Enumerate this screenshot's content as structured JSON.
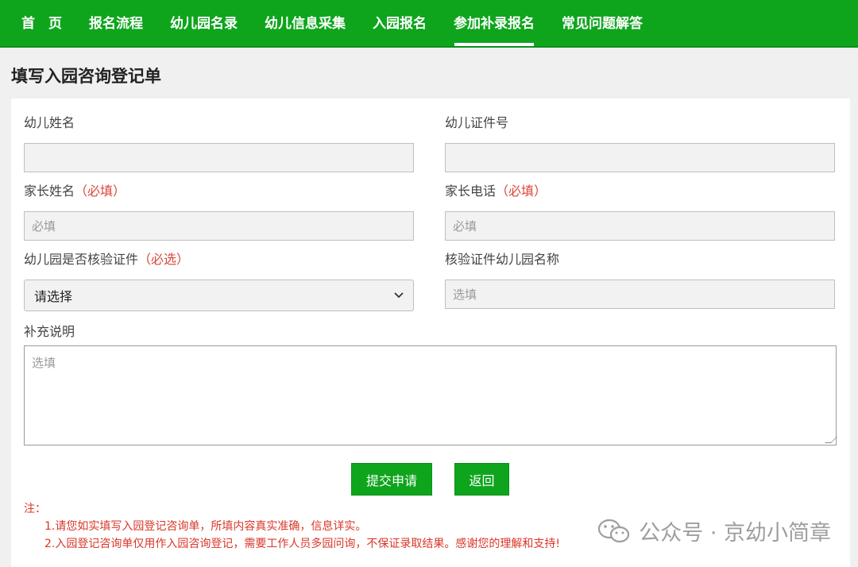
{
  "nav": {
    "items": [
      {
        "label": "首　页"
      },
      {
        "label": "报名流程"
      },
      {
        "label": "幼儿园名录"
      },
      {
        "label": "幼儿信息采集"
      },
      {
        "label": "入园报名"
      },
      {
        "label": "参加补录报名",
        "active": true
      },
      {
        "label": "常见问题解答"
      }
    ]
  },
  "page": {
    "title": "填写入园咨询登记单"
  },
  "form": {
    "child_name": {
      "label": "幼儿姓名",
      "value": ""
    },
    "child_id": {
      "label": "幼儿证件号",
      "value": ""
    },
    "parent_name": {
      "label": "家长姓名",
      "required_mark": "（必填）",
      "placeholder": "必填"
    },
    "parent_phone": {
      "label": "家长电话",
      "required_mark": "（必填）",
      "placeholder": "必填"
    },
    "verify": {
      "label": "幼儿园是否核验证件",
      "required_mark": "（必选）",
      "selected": "请选择"
    },
    "verify_kg_name": {
      "label": "核验证件幼儿园名称",
      "placeholder": "选填"
    },
    "notes": {
      "label": "补充说明",
      "placeholder": "选填"
    }
  },
  "buttons": {
    "submit": "提交申请",
    "back": "返回"
  },
  "notice": {
    "title": "注：",
    "lines": [
      "1.请您如实填写入园登记咨询单，所填内容真实准确，信息详实。",
      "2.入园登记咨询单仅用作入园咨询登记，需要工作人员多园问询，不保证录取结果。感谢您的理解和支持!"
    ]
  },
  "watermark": {
    "text": "公众号 · 京幼小简章",
    "icon": "wechat-icon"
  },
  "colors": {
    "brand_green": "#0ea51d",
    "required_red": "#d9463b"
  }
}
